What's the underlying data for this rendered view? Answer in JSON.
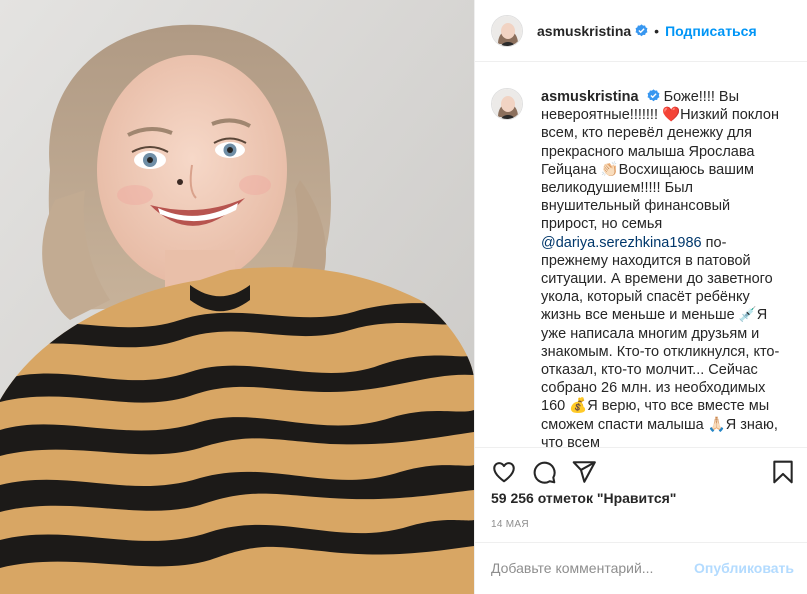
{
  "header": {
    "username": "asmuskristina",
    "dot": "•",
    "follow_label": "Подписаться"
  },
  "caption": {
    "username": "asmuskristina",
    "text_before_mention": "Боже!!!! Вы невероятные!!!!!!! ❤️Низкий поклон всем, кто перевёл денежку для прекрасного малыша Ярослава Гейцана 👏🏻Восхищаюсь вашим великодушием!!!!! Был внушительный финансовый прирост, но семья ",
    "mention": "@dariya.serezhkina1986",
    "text_after_mention": " по-прежнему находится в патовой ситуации. А времени до заветного укола, который спасёт ребёнку жизнь все меньше и меньше 💉Я уже написала многим друзьям и знакомым. Кто-то откликнулся, кто-отказал, кто-то молчит... Сейчас собрано 26 млн. из необходимых 160 💰Я верю, что все вместе мы сможем спасти малыша 🙏🏻Я знаю, что всем"
  },
  "actions": {
    "like_icon": "heart-outline-icon",
    "comment_icon": "comment-bubble-icon",
    "share_icon": "paper-plane-icon",
    "save_icon": "bookmark-icon"
  },
  "likes_text": "59 256 отметок \"Нравится\"",
  "date_text": "14 МАЯ",
  "comment": {
    "placeholder": "Добавьте комментарий...",
    "publish_label": "Опубликовать"
  },
  "colors": {
    "accent_blue": "#0095f6",
    "publish_disabled": "#b3dbff",
    "mention": "#00376b",
    "verified_badge": "#3897f0"
  }
}
